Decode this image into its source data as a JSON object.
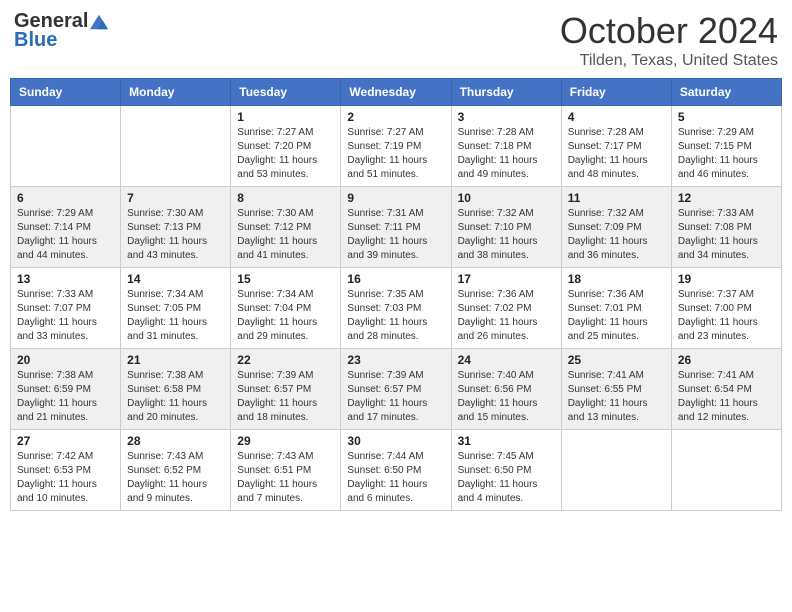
{
  "header": {
    "logo_general": "General",
    "logo_blue": "Blue",
    "month": "October 2024",
    "location": "Tilden, Texas, United States"
  },
  "days_of_week": [
    "Sunday",
    "Monday",
    "Tuesday",
    "Wednesday",
    "Thursday",
    "Friday",
    "Saturday"
  ],
  "weeks": [
    [
      {
        "day": "",
        "sunrise": "",
        "sunset": "",
        "daylight": ""
      },
      {
        "day": "",
        "sunrise": "",
        "sunset": "",
        "daylight": ""
      },
      {
        "day": "1",
        "sunrise": "Sunrise: 7:27 AM",
        "sunset": "Sunset: 7:20 PM",
        "daylight": "Daylight: 11 hours and 53 minutes."
      },
      {
        "day": "2",
        "sunrise": "Sunrise: 7:27 AM",
        "sunset": "Sunset: 7:19 PM",
        "daylight": "Daylight: 11 hours and 51 minutes."
      },
      {
        "day": "3",
        "sunrise": "Sunrise: 7:28 AM",
        "sunset": "Sunset: 7:18 PM",
        "daylight": "Daylight: 11 hours and 49 minutes."
      },
      {
        "day": "4",
        "sunrise": "Sunrise: 7:28 AM",
        "sunset": "Sunset: 7:17 PM",
        "daylight": "Daylight: 11 hours and 48 minutes."
      },
      {
        "day": "5",
        "sunrise": "Sunrise: 7:29 AM",
        "sunset": "Sunset: 7:15 PM",
        "daylight": "Daylight: 11 hours and 46 minutes."
      }
    ],
    [
      {
        "day": "6",
        "sunrise": "Sunrise: 7:29 AM",
        "sunset": "Sunset: 7:14 PM",
        "daylight": "Daylight: 11 hours and 44 minutes."
      },
      {
        "day": "7",
        "sunrise": "Sunrise: 7:30 AM",
        "sunset": "Sunset: 7:13 PM",
        "daylight": "Daylight: 11 hours and 43 minutes."
      },
      {
        "day": "8",
        "sunrise": "Sunrise: 7:30 AM",
        "sunset": "Sunset: 7:12 PM",
        "daylight": "Daylight: 11 hours and 41 minutes."
      },
      {
        "day": "9",
        "sunrise": "Sunrise: 7:31 AM",
        "sunset": "Sunset: 7:11 PM",
        "daylight": "Daylight: 11 hours and 39 minutes."
      },
      {
        "day": "10",
        "sunrise": "Sunrise: 7:32 AM",
        "sunset": "Sunset: 7:10 PM",
        "daylight": "Daylight: 11 hours and 38 minutes."
      },
      {
        "day": "11",
        "sunrise": "Sunrise: 7:32 AM",
        "sunset": "Sunset: 7:09 PM",
        "daylight": "Daylight: 11 hours and 36 minutes."
      },
      {
        "day": "12",
        "sunrise": "Sunrise: 7:33 AM",
        "sunset": "Sunset: 7:08 PM",
        "daylight": "Daylight: 11 hours and 34 minutes."
      }
    ],
    [
      {
        "day": "13",
        "sunrise": "Sunrise: 7:33 AM",
        "sunset": "Sunset: 7:07 PM",
        "daylight": "Daylight: 11 hours and 33 minutes."
      },
      {
        "day": "14",
        "sunrise": "Sunrise: 7:34 AM",
        "sunset": "Sunset: 7:05 PM",
        "daylight": "Daylight: 11 hours and 31 minutes."
      },
      {
        "day": "15",
        "sunrise": "Sunrise: 7:34 AM",
        "sunset": "Sunset: 7:04 PM",
        "daylight": "Daylight: 11 hours and 29 minutes."
      },
      {
        "day": "16",
        "sunrise": "Sunrise: 7:35 AM",
        "sunset": "Sunset: 7:03 PM",
        "daylight": "Daylight: 11 hours and 28 minutes."
      },
      {
        "day": "17",
        "sunrise": "Sunrise: 7:36 AM",
        "sunset": "Sunset: 7:02 PM",
        "daylight": "Daylight: 11 hours and 26 minutes."
      },
      {
        "day": "18",
        "sunrise": "Sunrise: 7:36 AM",
        "sunset": "Sunset: 7:01 PM",
        "daylight": "Daylight: 11 hours and 25 minutes."
      },
      {
        "day": "19",
        "sunrise": "Sunrise: 7:37 AM",
        "sunset": "Sunset: 7:00 PM",
        "daylight": "Daylight: 11 hours and 23 minutes."
      }
    ],
    [
      {
        "day": "20",
        "sunrise": "Sunrise: 7:38 AM",
        "sunset": "Sunset: 6:59 PM",
        "daylight": "Daylight: 11 hours and 21 minutes."
      },
      {
        "day": "21",
        "sunrise": "Sunrise: 7:38 AM",
        "sunset": "Sunset: 6:58 PM",
        "daylight": "Daylight: 11 hours and 20 minutes."
      },
      {
        "day": "22",
        "sunrise": "Sunrise: 7:39 AM",
        "sunset": "Sunset: 6:57 PM",
        "daylight": "Daylight: 11 hours and 18 minutes."
      },
      {
        "day": "23",
        "sunrise": "Sunrise: 7:39 AM",
        "sunset": "Sunset: 6:57 PM",
        "daylight": "Daylight: 11 hours and 17 minutes."
      },
      {
        "day": "24",
        "sunrise": "Sunrise: 7:40 AM",
        "sunset": "Sunset: 6:56 PM",
        "daylight": "Daylight: 11 hours and 15 minutes."
      },
      {
        "day": "25",
        "sunrise": "Sunrise: 7:41 AM",
        "sunset": "Sunset: 6:55 PM",
        "daylight": "Daylight: 11 hours and 13 minutes."
      },
      {
        "day": "26",
        "sunrise": "Sunrise: 7:41 AM",
        "sunset": "Sunset: 6:54 PM",
        "daylight": "Daylight: 11 hours and 12 minutes."
      }
    ],
    [
      {
        "day": "27",
        "sunrise": "Sunrise: 7:42 AM",
        "sunset": "Sunset: 6:53 PM",
        "daylight": "Daylight: 11 hours and 10 minutes."
      },
      {
        "day": "28",
        "sunrise": "Sunrise: 7:43 AM",
        "sunset": "Sunset: 6:52 PM",
        "daylight": "Daylight: 11 hours and 9 minutes."
      },
      {
        "day": "29",
        "sunrise": "Sunrise: 7:43 AM",
        "sunset": "Sunset: 6:51 PM",
        "daylight": "Daylight: 11 hours and 7 minutes."
      },
      {
        "day": "30",
        "sunrise": "Sunrise: 7:44 AM",
        "sunset": "Sunset: 6:50 PM",
        "daylight": "Daylight: 11 hours and 6 minutes."
      },
      {
        "day": "31",
        "sunrise": "Sunrise: 7:45 AM",
        "sunset": "Sunset: 6:50 PM",
        "daylight": "Daylight: 11 hours and 4 minutes."
      },
      {
        "day": "",
        "sunrise": "",
        "sunset": "",
        "daylight": ""
      },
      {
        "day": "",
        "sunrise": "",
        "sunset": "",
        "daylight": ""
      }
    ]
  ]
}
